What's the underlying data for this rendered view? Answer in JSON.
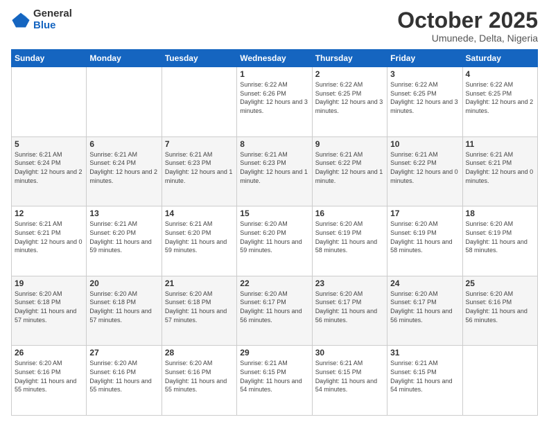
{
  "logo": {
    "general": "General",
    "blue": "Blue"
  },
  "header": {
    "month": "October 2025",
    "location": "Umunede, Delta, Nigeria"
  },
  "days_of_week": [
    "Sunday",
    "Monday",
    "Tuesday",
    "Wednesday",
    "Thursday",
    "Friday",
    "Saturday"
  ],
  "weeks": [
    [
      null,
      null,
      null,
      {
        "day": 1,
        "sunrise": "6:22 AM",
        "sunset": "6:26 PM",
        "daylight": "12 hours and 3 minutes."
      },
      {
        "day": 2,
        "sunrise": "6:22 AM",
        "sunset": "6:25 PM",
        "daylight": "12 hours and 3 minutes."
      },
      {
        "day": 3,
        "sunrise": "6:22 AM",
        "sunset": "6:25 PM",
        "daylight": "12 hours and 3 minutes."
      },
      {
        "day": 4,
        "sunrise": "6:22 AM",
        "sunset": "6:25 PM",
        "daylight": "12 hours and 2 minutes."
      }
    ],
    [
      {
        "day": 5,
        "sunrise": "6:21 AM",
        "sunset": "6:24 PM",
        "daylight": "12 hours and 2 minutes."
      },
      {
        "day": 6,
        "sunrise": "6:21 AM",
        "sunset": "6:24 PM",
        "daylight": "12 hours and 2 minutes."
      },
      {
        "day": 7,
        "sunrise": "6:21 AM",
        "sunset": "6:23 PM",
        "daylight": "12 hours and 1 minute."
      },
      {
        "day": 8,
        "sunrise": "6:21 AM",
        "sunset": "6:23 PM",
        "daylight": "12 hours and 1 minute."
      },
      {
        "day": 9,
        "sunrise": "6:21 AM",
        "sunset": "6:22 PM",
        "daylight": "12 hours and 1 minute."
      },
      {
        "day": 10,
        "sunrise": "6:21 AM",
        "sunset": "6:22 PM",
        "daylight": "12 hours and 0 minutes."
      },
      {
        "day": 11,
        "sunrise": "6:21 AM",
        "sunset": "6:21 PM",
        "daylight": "12 hours and 0 minutes."
      }
    ],
    [
      {
        "day": 12,
        "sunrise": "6:21 AM",
        "sunset": "6:21 PM",
        "daylight": "12 hours and 0 minutes."
      },
      {
        "day": 13,
        "sunrise": "6:21 AM",
        "sunset": "6:20 PM",
        "daylight": "11 hours and 59 minutes."
      },
      {
        "day": 14,
        "sunrise": "6:21 AM",
        "sunset": "6:20 PM",
        "daylight": "11 hours and 59 minutes."
      },
      {
        "day": 15,
        "sunrise": "6:20 AM",
        "sunset": "6:20 PM",
        "daylight": "11 hours and 59 minutes."
      },
      {
        "day": 16,
        "sunrise": "6:20 AM",
        "sunset": "6:19 PM",
        "daylight": "11 hours and 58 minutes."
      },
      {
        "day": 17,
        "sunrise": "6:20 AM",
        "sunset": "6:19 PM",
        "daylight": "11 hours and 58 minutes."
      },
      {
        "day": 18,
        "sunrise": "6:20 AM",
        "sunset": "6:19 PM",
        "daylight": "11 hours and 58 minutes."
      }
    ],
    [
      {
        "day": 19,
        "sunrise": "6:20 AM",
        "sunset": "6:18 PM",
        "daylight": "11 hours and 57 minutes."
      },
      {
        "day": 20,
        "sunrise": "6:20 AM",
        "sunset": "6:18 PM",
        "daylight": "11 hours and 57 minutes."
      },
      {
        "day": 21,
        "sunrise": "6:20 AM",
        "sunset": "6:18 PM",
        "daylight": "11 hours and 57 minutes."
      },
      {
        "day": 22,
        "sunrise": "6:20 AM",
        "sunset": "6:17 PM",
        "daylight": "11 hours and 56 minutes."
      },
      {
        "day": 23,
        "sunrise": "6:20 AM",
        "sunset": "6:17 PM",
        "daylight": "11 hours and 56 minutes."
      },
      {
        "day": 24,
        "sunrise": "6:20 AM",
        "sunset": "6:17 PM",
        "daylight": "11 hours and 56 minutes."
      },
      {
        "day": 25,
        "sunrise": "6:20 AM",
        "sunset": "6:16 PM",
        "daylight": "11 hours and 56 minutes."
      }
    ],
    [
      {
        "day": 26,
        "sunrise": "6:20 AM",
        "sunset": "6:16 PM",
        "daylight": "11 hours and 55 minutes."
      },
      {
        "day": 27,
        "sunrise": "6:20 AM",
        "sunset": "6:16 PM",
        "daylight": "11 hours and 55 minutes."
      },
      {
        "day": 28,
        "sunrise": "6:20 AM",
        "sunset": "6:16 PM",
        "daylight": "11 hours and 55 minutes."
      },
      {
        "day": 29,
        "sunrise": "6:21 AM",
        "sunset": "6:15 PM",
        "daylight": "11 hours and 54 minutes."
      },
      {
        "day": 30,
        "sunrise": "6:21 AM",
        "sunset": "6:15 PM",
        "daylight": "11 hours and 54 minutes."
      },
      {
        "day": 31,
        "sunrise": "6:21 AM",
        "sunset": "6:15 PM",
        "daylight": "11 hours and 54 minutes."
      },
      null
    ]
  ]
}
